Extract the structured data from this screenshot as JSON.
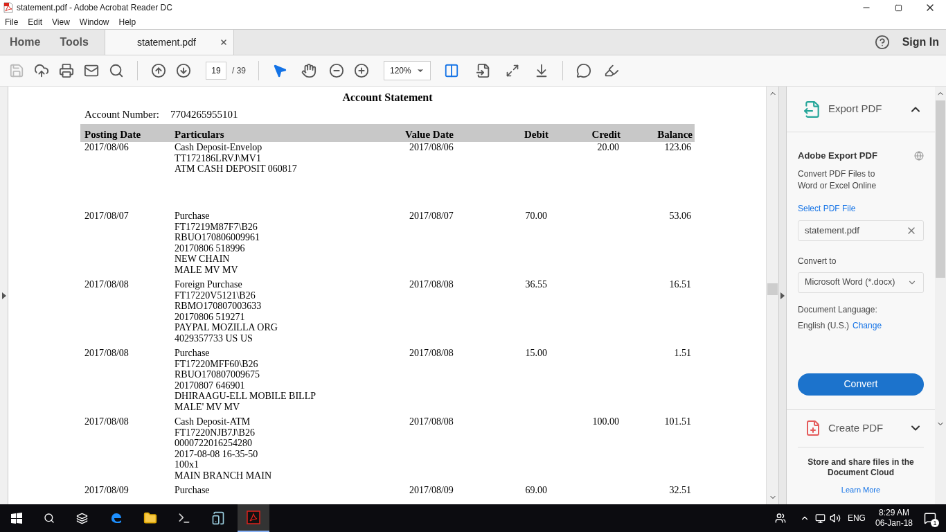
{
  "window": {
    "title": "statement.pdf - Adobe Acrobat Reader DC"
  },
  "menu": [
    "File",
    "Edit",
    "View",
    "Window",
    "Help"
  ],
  "tabs": [
    {
      "label": "Home",
      "selected": false
    },
    {
      "label": "Tools",
      "selected": false
    },
    {
      "label": "statement.pdf",
      "selected": true
    }
  ],
  "header_right": {
    "sign_in": "Sign In"
  },
  "toolbar": {
    "page": "19",
    "page_count": "/ 39",
    "zoom": "120%"
  },
  "document": {
    "title": "Account Statement",
    "account_label": "Account Number:",
    "account_number": "7704265955101",
    "columns": [
      "Posting Date",
      "Particulars",
      "Value Date",
      "Debit",
      "Credit",
      "Balance"
    ],
    "rows": [
      {
        "posting_date": "2017/08/06",
        "particulars": [
          "Cash Deposit-Envelop",
          "TT172186LRVJ\\MV1",
          "ATM CASH DEPOSIT 060817"
        ],
        "value_date": "2017/08/06",
        "debit": "",
        "credit": "20.00",
        "balance": "123.06"
      },
      {
        "posting_date": "2017/08/07",
        "particulars": [
          "Purchase",
          "FT17219M87F7\\B26",
          "RBUO170806009961",
          "20170806 518996",
          "NEW CHAIN",
          "MALE MV MV"
        ],
        "value_date": "2017/08/07",
        "debit": "70.00",
        "credit": "",
        "balance": "53.06"
      },
      {
        "posting_date": "2017/08/08",
        "particulars": [
          "Foreign Purchase",
          "FT17220V5121\\B26",
          "RBMO170807003633",
          "20170806 519271",
          "PAYPAL MOZILLA ORG",
          "4029357733 US US"
        ],
        "value_date": "2017/08/08",
        "debit": "36.55",
        "credit": "",
        "balance": "16.51"
      },
      {
        "posting_date": "2017/08/08",
        "particulars": [
          "Purchase",
          "FT17220MFF60\\B26",
          "RBUO170807009675",
          "20170807 646901",
          "DHIRAAGU-ELL MOBILE BILLP",
          "MALE' MV MV"
        ],
        "value_date": "2017/08/08",
        "debit": "15.00",
        "credit": "",
        "balance": "1.51"
      },
      {
        "posting_date": "2017/08/08",
        "particulars": [
          "Cash Deposit-ATM",
          "FT17220NJB7J\\B26",
          "0000722016254280",
          "2017-08-08 16-35-50",
          "100x1",
          "MAIN BRANCH MAIN"
        ],
        "value_date": "2017/08/08",
        "debit": "",
        "credit": "100.00",
        "balance": "101.51"
      },
      {
        "posting_date": "2017/08/09",
        "particulars": [
          "Purchase"
        ],
        "value_date": "2017/08/09",
        "debit": "69.00",
        "credit": "",
        "balance": "32.51"
      }
    ]
  },
  "panel": {
    "export": {
      "title": "Export PDF",
      "expanded": true,
      "heading": "Adobe Export PDF",
      "description": "Convert PDF Files to Word or Excel Online",
      "select_label": "Select PDF File",
      "file": "statement.pdf",
      "convert_to_label": "Convert to",
      "format": "Microsoft Word (*.docx)",
      "language_label": "Document Language:",
      "language": "English (U.S.)",
      "change": "Change",
      "convert": "Convert"
    },
    "create": {
      "title": "Create PDF",
      "expanded": false
    },
    "cloud": {
      "text": "Store and share files in the Document Cloud",
      "link": "Learn More"
    }
  },
  "taskbar": {
    "language": "ENG",
    "time": "8:29 AM",
    "date": "06-Jan-18",
    "notifications": "1"
  }
}
